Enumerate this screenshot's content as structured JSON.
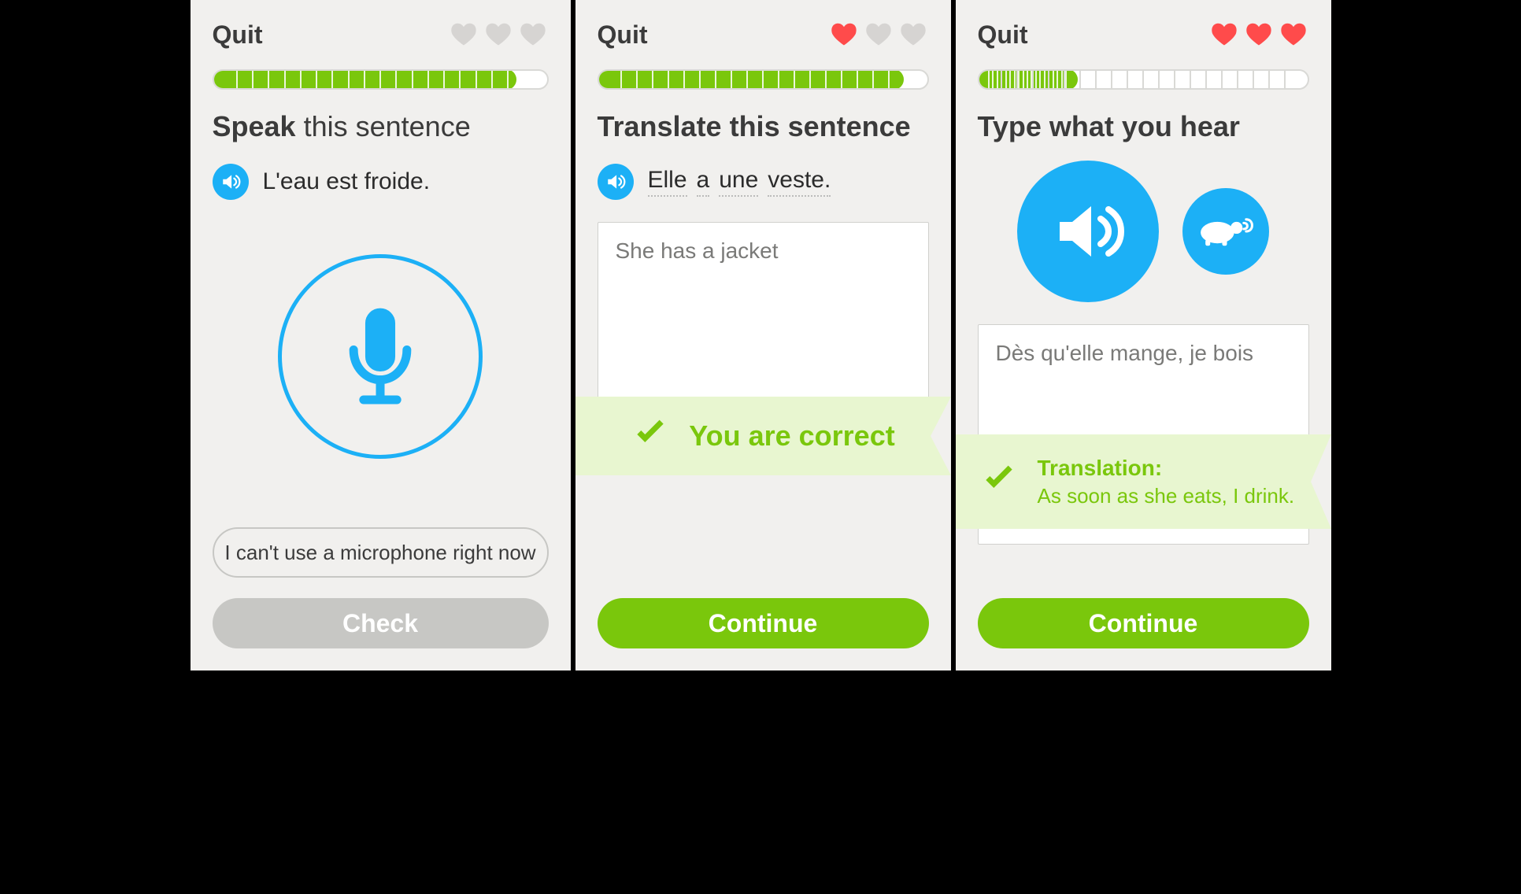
{
  "colors": {
    "accent_blue": "#1cb0f6",
    "accent_green": "#7ac70c",
    "heart_red": "#ff4b4b",
    "heart_grey": "#d6d4d2"
  },
  "panels": [
    {
      "quit_label": "Quit",
      "hearts_filled": 0,
      "hearts_total": 3,
      "progress_pct": 91,
      "prompt_bold": "Speak",
      "prompt_rest": " this sentence",
      "sentence_words": [
        "L'eau est froide."
      ],
      "sentence_underlined": false,
      "no_mic_label": "I can't use a microphone right now",
      "action_label": "Check",
      "action_state": "disabled"
    },
    {
      "quit_label": "Quit",
      "hearts_filled": 1,
      "hearts_total": 3,
      "progress_pct": 93,
      "prompt_bold": "Translate this sentence",
      "prompt_rest": "",
      "sentence_words": [
        "Elle",
        "a",
        "une",
        "veste."
      ],
      "sentence_underlined": true,
      "answer_text": "She has a jacket",
      "ribbon_msg": "You are correct",
      "action_label": "Continue",
      "action_state": "green"
    },
    {
      "quit_label": "Quit",
      "hearts_filled": 3,
      "hearts_total": 3,
      "progress_pct": 30,
      "prompt_bold": "Type what you hear",
      "prompt_rest": "",
      "answer_text": "Dès qu'elle mange, je bois",
      "ribbon_label": "Translation:",
      "ribbon_translation": "As soon as she eats, I drink.",
      "action_label": "Continue",
      "action_state": "green"
    }
  ]
}
